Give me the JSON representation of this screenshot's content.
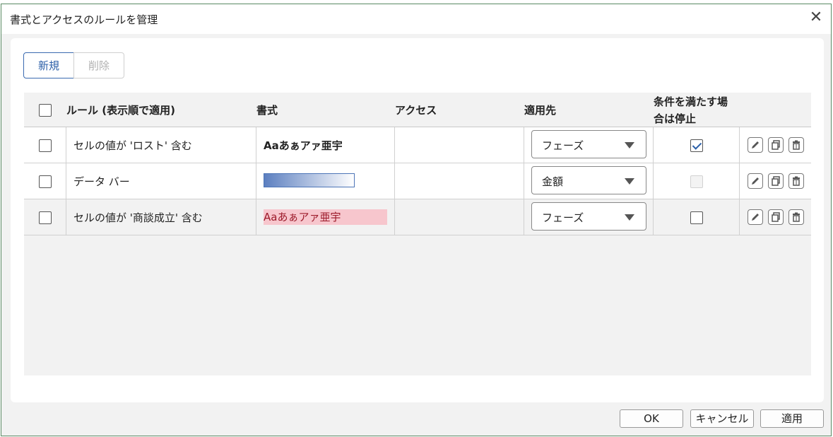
{
  "window": {
    "title": "書式とアクセスのルールを管理",
    "close_icon": "close-icon"
  },
  "toolbar": {
    "new_label": "新規",
    "delete_label": "削除"
  },
  "table": {
    "headers": {
      "rule": "ルール (表示順で適用)",
      "format": "書式",
      "access": "アクセス",
      "applies_to": "適用先",
      "stop_line1": "条件を満たす場",
      "stop_line2": "合は停止"
    },
    "rows": [
      {
        "rule": "セルの値が 'ロスト' 含む",
        "format_preview": "Aaあぁアァ亜宇",
        "format_style": "bold",
        "access": "",
        "applies_to": "フェーズ",
        "stop_if_true": true
      },
      {
        "rule": "データ バー",
        "format_preview": "",
        "format_style": "data-bar",
        "access": "",
        "applies_to": "金額",
        "stop_if_true": false
      },
      {
        "rule": "セルの値が '商談成立' 含む",
        "format_preview": "Aaあぁアァ亜宇",
        "format_style": "pink-fill",
        "access": "",
        "applies_to": "フェーズ",
        "stop_if_true": false
      }
    ]
  },
  "footer": {
    "ok_label": "OK",
    "cancel_label": "キャンセル",
    "apply_label": "適用"
  },
  "colors": {
    "accent": "#2b5fa8",
    "pink_fill": "#f7c6cd",
    "pink_text": "#9c1a2a",
    "databar": "#5c7fc0"
  }
}
